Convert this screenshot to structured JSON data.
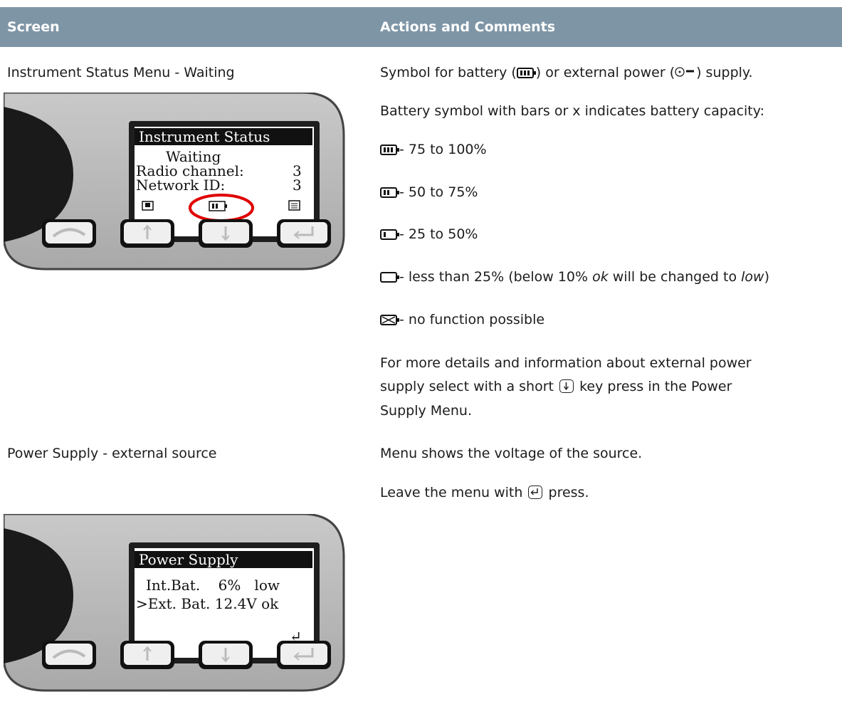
{
  "header": {
    "col1": "Screen",
    "col2": "Actions and Comments"
  },
  "row1": {
    "screen_label": "Instrument Status Menu - Waiting",
    "device": {
      "title": "Instrument Status",
      "line1": "Waiting",
      "line2_label": "Radio channel:",
      "line2_value": "3",
      "line3_label": "Network ID:",
      "line3_value": "3"
    },
    "comments": {
      "p1_pre": "Symbol for battery (",
      "p1_mid": ") or external power (",
      "p1_post": ") supply.",
      "p2": "Battery symbol with bars or x indicates battery capacity:",
      "b3": "- 75 to 100%",
      "b2": "- 50 to 75%",
      "b1": "- 25 to 50%",
      "b0_pre": "- less than 25% (below 10% ",
      "b0_ok": "ok",
      "b0_mid": " will be changed to ",
      "b0_low": "low",
      "b0_post": ")",
      "bx": "- no function possible",
      "p3_line1": "For more details and information about external power",
      "p3_line2_pre": "supply select with a short",
      "p3_line2_post": "key press in the Power",
      "p3_line3": "Supply Menu."
    }
  },
  "row2": {
    "screen_label": "Power Supply - external source",
    "device": {
      "title": "Power Supply",
      "line1": "Int.Bat.    6%   low",
      "line2": ">Ext. Bat. 12.4V ok",
      "enter_symbol": "↵"
    },
    "comments": {
      "p1": "Menu shows the voltage of the source.",
      "p2_pre": "Leave the menu with",
      "p2_post": "press."
    }
  },
  "colors": {
    "header": "#7e95a6",
    "highlight": "#e00000"
  }
}
